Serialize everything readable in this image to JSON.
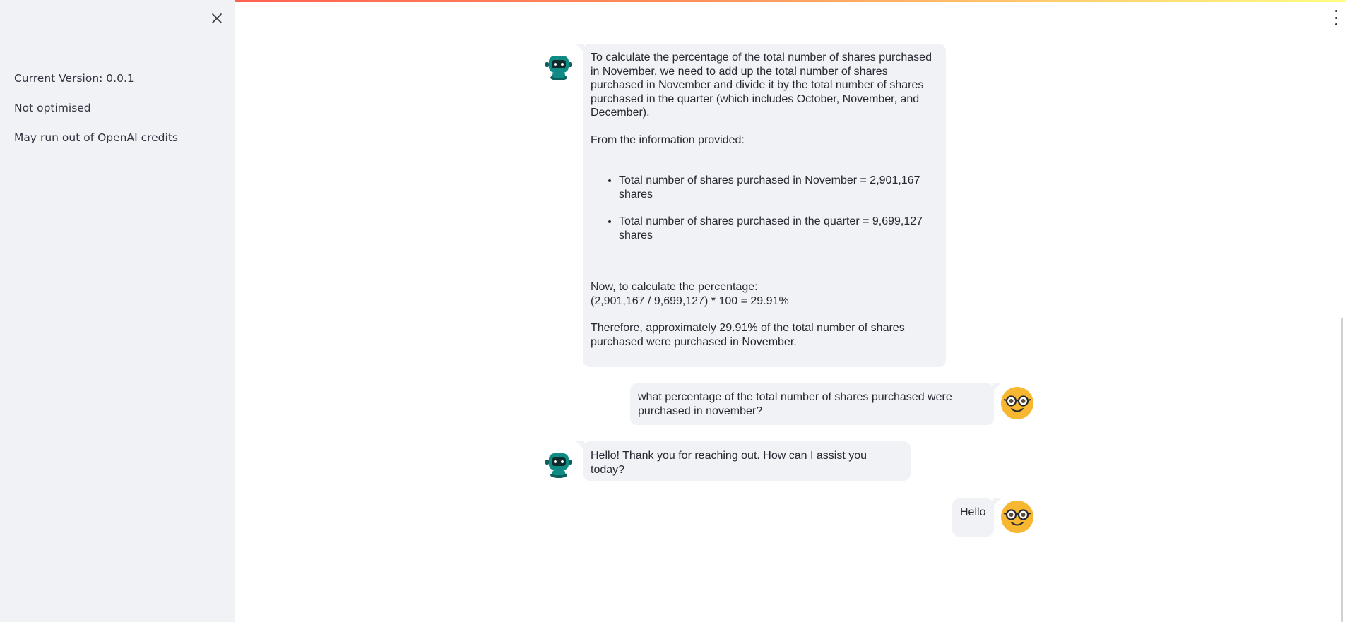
{
  "sidebar": {
    "close_icon": "close-icon",
    "version_text": "Current Version: 0.0.1",
    "status_text": "Not optimised",
    "warning_text": "May run out of OpenAI credits"
  },
  "header": {
    "menu_icon": "kebab-menu-icon"
  },
  "chat": {
    "messages": [
      {
        "role": "assistant",
        "avatar_icon": "robot-icon",
        "intro": "To calculate the percentage of the total number of shares purchased in November, we need to add up the total number of shares purchased in November and divide it by the total number of shares purchased in the quarter (which includes October, November, and December).",
        "lead": "From the information provided:",
        "bullets": [
          "Total number of shares purchased in November = 2,901,167 shares",
          "Total number of shares purchased in the quarter = 9,699,127 shares"
        ],
        "calc_line_1": "Now, to calculate the percentage:",
        "calc_line_2": "(2,901,167 / 9,699,127) * 100 = 29.91%",
        "conclusion": "Therefore, approximately 29.91% of the total number of shares purchased were purchased in November."
      },
      {
        "role": "user",
        "avatar_icon": "nerd-face-icon",
        "text": "what percentage of the total number of shares purchased were purchased in november?"
      },
      {
        "role": "assistant",
        "avatar_icon": "robot-icon",
        "text": "Hello! Thank you for reaching out. How can I assist you today?"
      },
      {
        "role": "user",
        "avatar_icon": "nerd-face-icon",
        "text": "Hello"
      }
    ]
  },
  "colors": {
    "sidebar_bg": "#f0f2f6",
    "bubble_bg": "#f0f2f6",
    "user_avatar": "#f7b731",
    "bot_avatar": "#0f8a84"
  }
}
